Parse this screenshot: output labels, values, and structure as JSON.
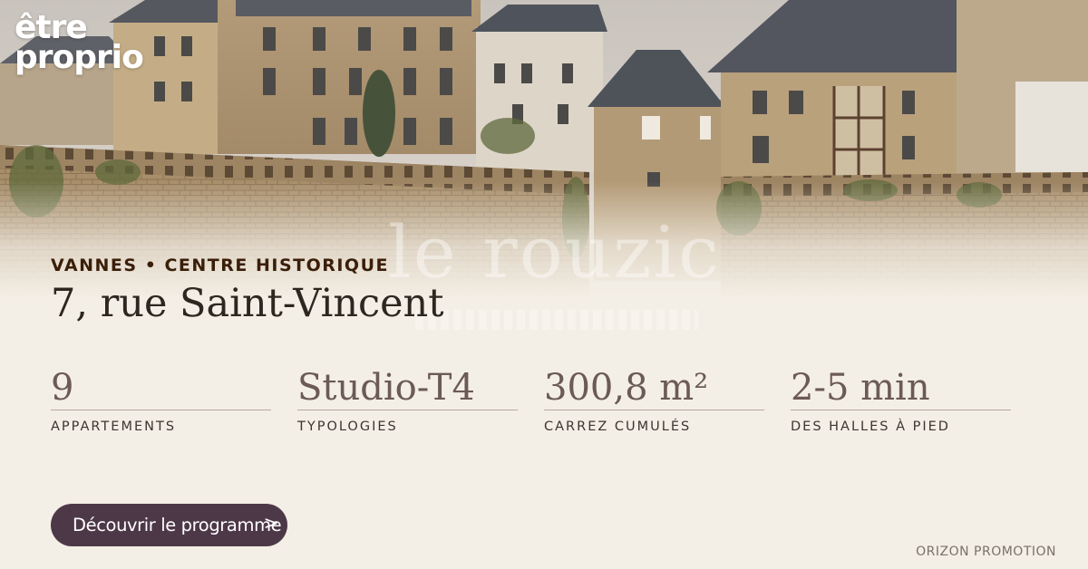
{
  "brand": {
    "logo_line1": "être",
    "logo_line2": "proprio"
  },
  "hero": {
    "image_subject": "Remparts et maisons historiques de Vannes",
    "watermark_text": "le rouzic"
  },
  "location": {
    "kicker": "VANNES • CENTRE HISTORIQUE",
    "address": "7, rue Saint-Vincent"
  },
  "stats": [
    {
      "value": "9",
      "label": "APPARTEMENTS"
    },
    {
      "value": "Studio-T4",
      "label": "TYPOLOGIES"
    },
    {
      "value": "300,8 m²",
      "label": "CARREZ CUMULÉS"
    },
    {
      "value": "2-5 min",
      "label": "DES HALLES À PIED"
    }
  ],
  "cta": {
    "label": "Découvrir le programme",
    "arrow": ">"
  },
  "footer": {
    "promoter": "ORIZON PROMOTION"
  },
  "colors": {
    "background": "#f4efe6",
    "cta_bg": "#4d3848",
    "kicker": "#3a1e08",
    "stat_value": "#6b5a55"
  }
}
